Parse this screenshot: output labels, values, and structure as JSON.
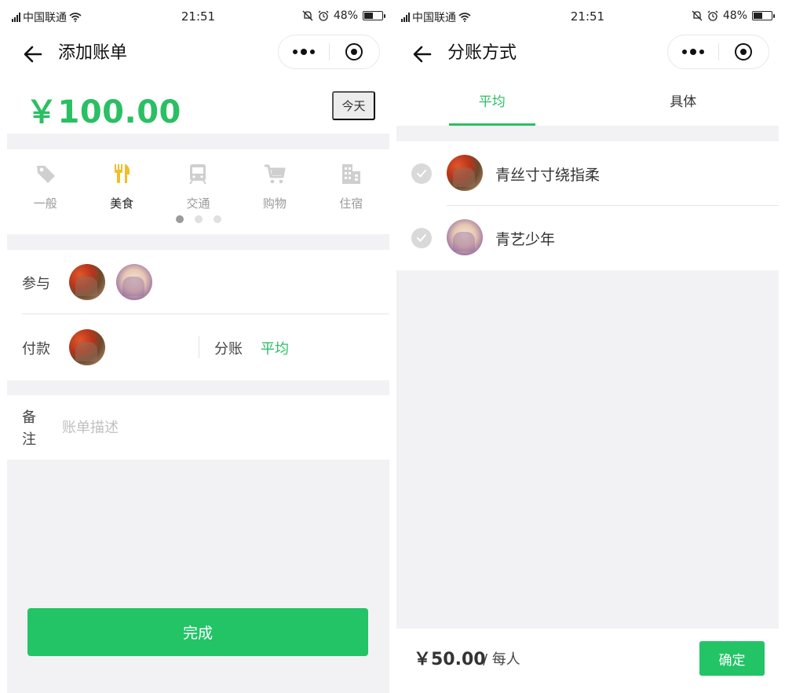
{
  "status_bar": {
    "carrier": "中国联通",
    "time": "21:51",
    "battery": "48%"
  },
  "add_bill": {
    "title": "添加账单",
    "amount": "￥100.00",
    "date_button": "今天",
    "categories": [
      {
        "label": "一般",
        "icon": "tag-icon"
      },
      {
        "label": "美食",
        "icon": "fork-knife-icon"
      },
      {
        "label": "交通",
        "icon": "train-icon"
      },
      {
        "label": "购物",
        "icon": "cart-icon"
      },
      {
        "label": "住宿",
        "icon": "building-icon"
      }
    ],
    "selected_category": "美食",
    "participants_label": "参与",
    "payer_label": "付款",
    "split_label": "分账",
    "split_value": "平均",
    "note_label": "备注",
    "note_placeholder": "账单描述",
    "done_button": "完成"
  },
  "split_method": {
    "title": "分账方式",
    "tabs": [
      "平均",
      "具体"
    ],
    "active_tab": "平均",
    "members": [
      {
        "name": "青丝寸寸绕指柔"
      },
      {
        "name": "青艺少年"
      }
    ],
    "per_person_amount": "￥50.00",
    "per_person_unit": "/ 每人",
    "confirm_button": "确定"
  },
  "colors": {
    "accent": "#2bbf63",
    "button": "#22c466",
    "category_active": "#f2bd2a",
    "category_inactive": "#cfcfcf",
    "background": "#f2f2f4"
  }
}
